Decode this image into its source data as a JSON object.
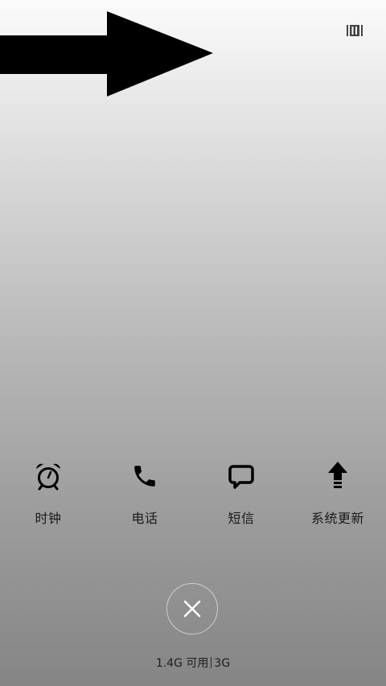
{
  "quick_actions": [
    {
      "label": "时钟",
      "icon": "alarm-clock-icon"
    },
    {
      "label": "电话",
      "icon": "phone-icon"
    },
    {
      "label": "短信",
      "icon": "message-icon"
    },
    {
      "label": "系统更新",
      "icon": "upload-arrow-icon"
    }
  ],
  "memory_status": {
    "available": "1.4G 可用",
    "total": "3G"
  },
  "colors": {
    "icon": "#000000",
    "text": "#1a1a1a",
    "background_top": "#fbfbfb",
    "background_bottom": "#858585"
  }
}
